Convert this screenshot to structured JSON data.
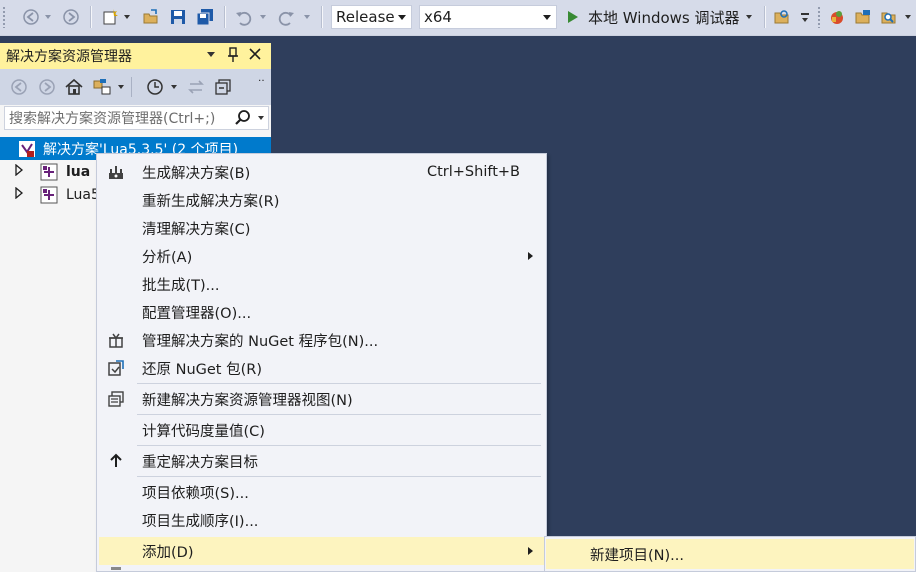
{
  "toolbar": {
    "config_value": "Release",
    "platform_value": "x64",
    "run_label": "本地 Windows 调试器"
  },
  "solution_explorer": {
    "title": "解决方案资源管理器",
    "search_placeholder": "搜索解决方案资源管理器(Ctrl+;)",
    "tree": [
      {
        "label": "解决方案'Lua5.3.5' (2 个项目)"
      },
      {
        "label": "lua"
      },
      {
        "label": "Lua5"
      }
    ]
  },
  "context_menu": {
    "items": [
      {
        "label": "生成解决方案(B)",
        "shortcut": "Ctrl+Shift+B",
        "icon": "build-icon"
      },
      {
        "label": "重新生成解决方案(R)"
      },
      {
        "label": "清理解决方案(C)"
      },
      {
        "label": "分析(A)",
        "submenu": true
      },
      {
        "label": "批生成(T)..."
      },
      {
        "label": "配置管理器(O)..."
      },
      {
        "label": "管理解决方案的 NuGet 程序包(N)...",
        "icon": "nuget-package-icon"
      },
      {
        "label": "还原 NuGet 包(R)",
        "icon": "restore-icon"
      },
      {
        "label": "新建解决方案资源管理器视图(N)",
        "icon": "new-view-icon"
      },
      {
        "label": "计算代码度量值(C)"
      },
      {
        "label": "重定解决方案目标",
        "icon": "up-arrow-icon"
      },
      {
        "label": "项目依赖项(S)..."
      },
      {
        "label": "项目生成顺序(I)..."
      },
      {
        "label": "添加(D)",
        "submenu": true
      }
    ]
  },
  "submenu": {
    "items": [
      {
        "label": "新建项目(N)..."
      }
    ]
  },
  "colors": {
    "accent": "#007acc",
    "highlight": "#fdf4bf",
    "background": "#2f3e5c"
  }
}
